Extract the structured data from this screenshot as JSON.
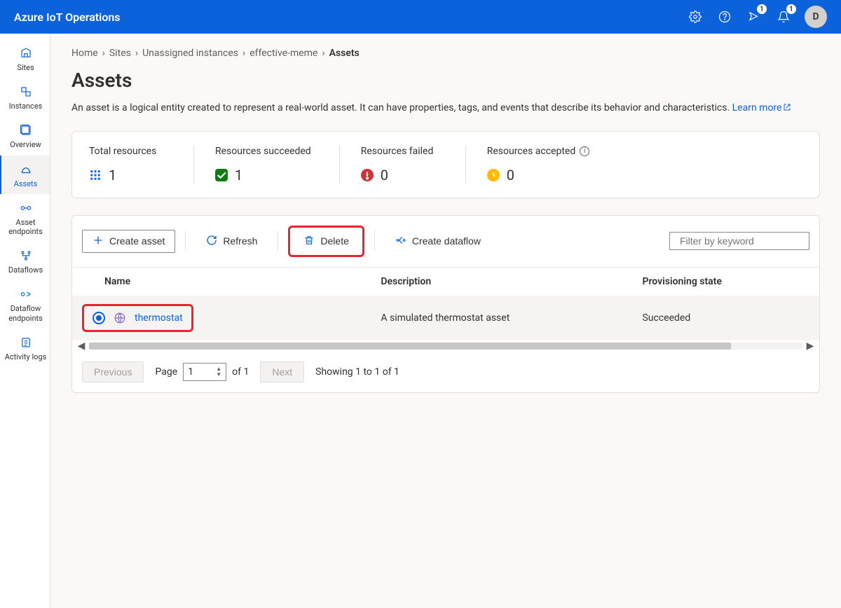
{
  "header": {
    "brand": "Azure IoT Operations",
    "badge1": "1",
    "badge2": "1",
    "avatar": "D"
  },
  "nav": {
    "items": [
      {
        "label": "Sites"
      },
      {
        "label": "Instances"
      },
      {
        "label": "Overview"
      },
      {
        "label": "Assets"
      },
      {
        "label": "Asset endpoints"
      },
      {
        "label": "Dataflows"
      },
      {
        "label": "Dataflow endpoints"
      },
      {
        "label": "Activity logs"
      }
    ]
  },
  "breadcrumb": {
    "home": "Home",
    "sites": "Sites",
    "unassigned": "Unassigned instances",
    "instance": "effective-meme",
    "current": "Assets"
  },
  "page": {
    "title": "Assets",
    "description": "An asset is a logical entity created to represent a real-world asset. It can have properties, tags, and events that describe its behavior and characteristics. ",
    "learn_more": "Learn more"
  },
  "summary": {
    "total_label": "Total resources",
    "total_value": "1",
    "succeeded_label": "Resources succeeded",
    "succeeded_value": "1",
    "failed_label": "Resources failed",
    "failed_value": "0",
    "accepted_label": "Resources accepted",
    "accepted_value": "0"
  },
  "toolbar": {
    "create": "Create asset",
    "refresh": "Refresh",
    "delete": "Delete",
    "create_dataflow": "Create dataflow",
    "filter_placeholder": "Filter by keyword"
  },
  "table": {
    "columns": {
      "name": "Name",
      "description": "Description",
      "state": "Provisioning state"
    },
    "rows": [
      {
        "name": "thermostat",
        "description": "A simulated thermostat asset",
        "state": "Succeeded"
      }
    ]
  },
  "pagination": {
    "previous": "Previous",
    "next": "Next",
    "page_label": "Page",
    "page_value": "1",
    "of_label": "of 1",
    "showing": "Showing 1 to 1 of 1"
  }
}
